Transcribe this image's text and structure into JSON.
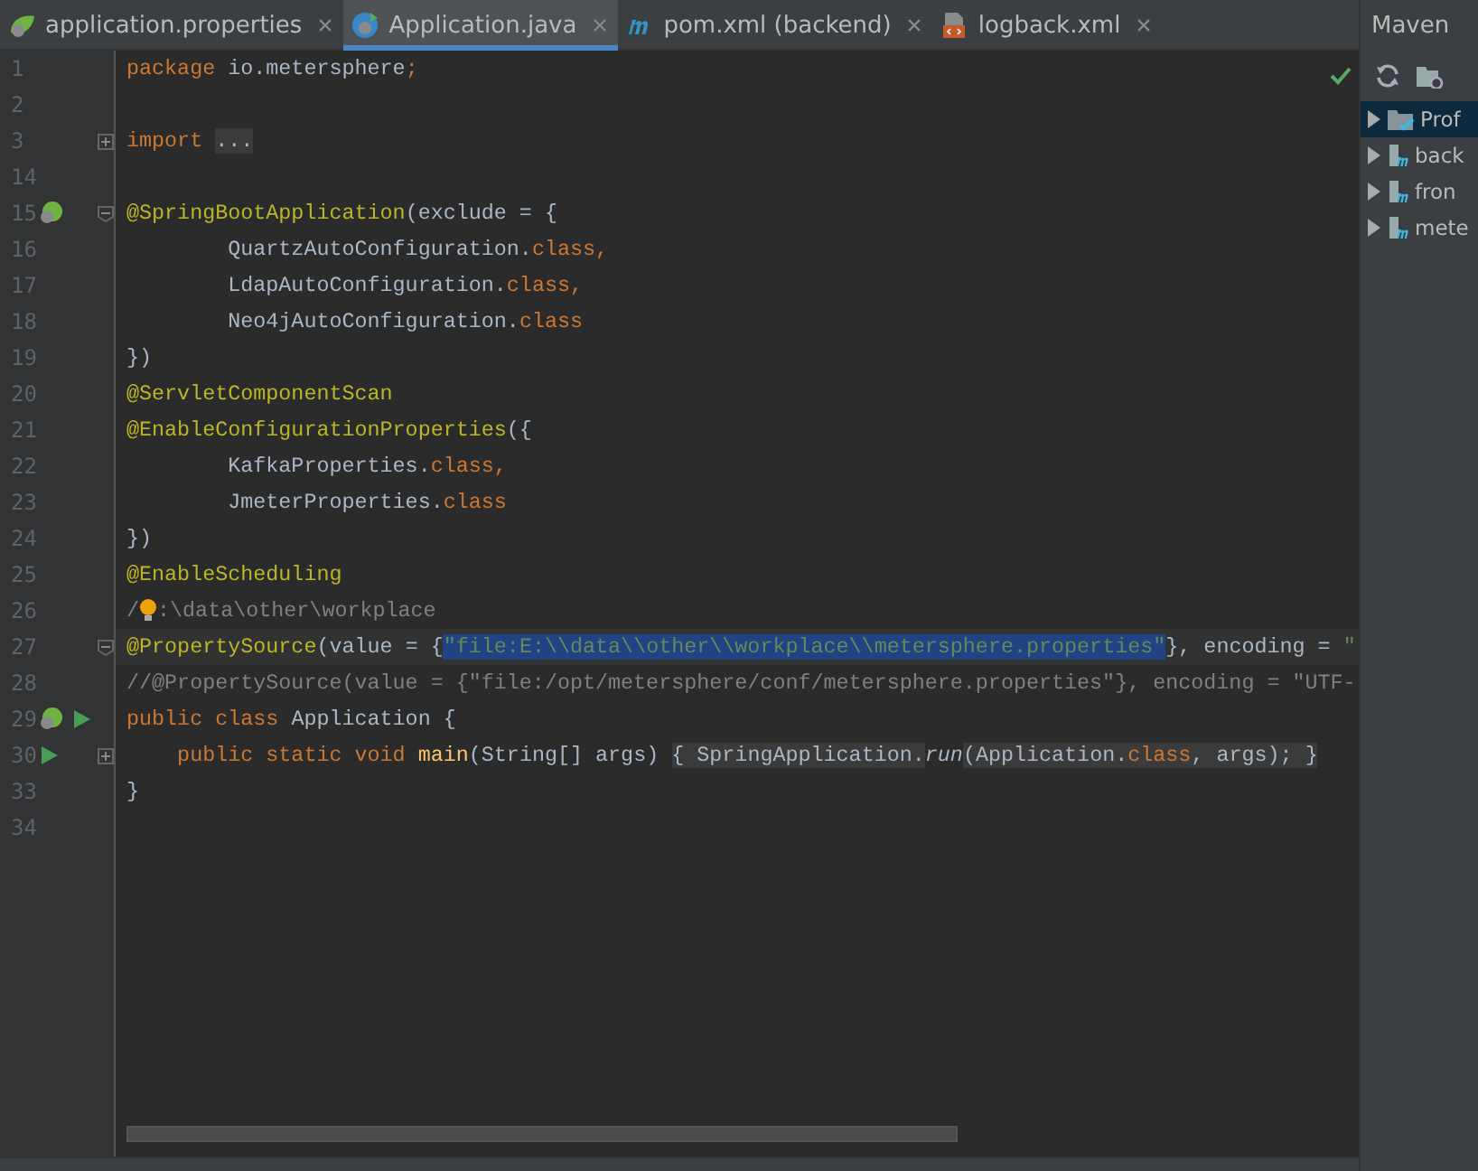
{
  "tabs": [
    {
      "label": "application.properties",
      "kind": "spring",
      "selected": false
    },
    {
      "label": "Application.java",
      "kind": "java",
      "selected": true
    },
    {
      "label": "pom.xml (backend)",
      "kind": "maven",
      "selected": false
    },
    {
      "label": "logback.xml",
      "kind": "xml",
      "selected": false
    }
  ],
  "editor": {
    "lines": [
      {
        "number": "1",
        "tokens": [
          {
            "kind": "kw",
            "text": "package "
          },
          {
            "kind": "plain",
            "text": "io.metersphere"
          },
          {
            "kind": "kw",
            "text": ";"
          }
        ]
      },
      {
        "number": "2"
      },
      {
        "number": "3",
        "fold": {
          "kind": "expand"
        },
        "tokens": [
          {
            "kind": "kw",
            "text": "import "
          },
          {
            "kind": "folded",
            "text": "..."
          }
        ]
      },
      {
        "number": "14"
      },
      {
        "number": "15",
        "fold": {
          "kind": "collapse"
        },
        "gutter": [
          {
            "kind": "bean"
          }
        ],
        "tokens": [
          {
            "kind": "ann",
            "text": "@SpringBootApplication"
          },
          {
            "kind": "plain",
            "text": "(exclude = {"
          }
        ]
      },
      {
        "number": "16",
        "tokens": [
          {
            "kind": "plain",
            "text": "        QuartzAutoConfiguration."
          },
          {
            "kind": "kw",
            "text": "class,"
          }
        ]
      },
      {
        "number": "17",
        "tokens": [
          {
            "kind": "plain",
            "text": "        LdapAutoConfiguration."
          },
          {
            "kind": "kw",
            "text": "class,"
          }
        ]
      },
      {
        "number": "18",
        "tokens": [
          {
            "kind": "plain",
            "text": "        Neo4jAutoConfiguration."
          },
          {
            "kind": "kw",
            "text": "class"
          }
        ]
      },
      {
        "number": "19",
        "tokens": [
          {
            "kind": "plain",
            "text": "})"
          }
        ]
      },
      {
        "number": "20",
        "tokens": [
          {
            "kind": "ann",
            "text": "@ServletComponentScan"
          }
        ]
      },
      {
        "number": "21",
        "tokens": [
          {
            "kind": "ann",
            "text": "@EnableConfigurationProperties"
          },
          {
            "kind": "plain",
            "text": "({"
          }
        ]
      },
      {
        "number": "22",
        "tokens": [
          {
            "kind": "plain",
            "text": "        KafkaProperties."
          },
          {
            "kind": "kw",
            "text": "class,"
          }
        ]
      },
      {
        "number": "23",
        "tokens": [
          {
            "kind": "plain",
            "text": "        JmeterProperties."
          },
          {
            "kind": "kw",
            "text": "class"
          }
        ]
      },
      {
        "number": "24",
        "tokens": [
          {
            "kind": "plain",
            "text": "})"
          }
        ]
      },
      {
        "number": "25",
        "tokens": [
          {
            "kind": "ann",
            "text": "@EnableScheduling"
          }
        ]
      },
      {
        "number": "26",
        "tokens": [
          {
            "kind": "cmt",
            "text": "/"
          },
          {
            "kind": "bulb"
          },
          {
            "kind": "cmt",
            "text": ":\\data\\other\\workplace"
          }
        ]
      },
      {
        "number": "27",
        "current": true,
        "fold": {
          "kind": "collapse"
        },
        "tokens": [
          {
            "kind": "ann",
            "text": "@PropertySource"
          },
          {
            "kind": "plain",
            "text": "(value = {"
          },
          {
            "kind": "str",
            "selected": true,
            "text": "\"file:E:\\\\data\\\\other\\\\workplace\\\\metersphere.properties\""
          },
          {
            "kind": "plain",
            "text": "}, encoding = "
          },
          {
            "kind": "str",
            "text": "\""
          }
        ]
      },
      {
        "number": "28",
        "tokens": [
          {
            "kind": "cmt",
            "text": "//@PropertySource(value = {\"file:/opt/metersphere/conf/metersphere.properties\"}, encoding = \"UTF-"
          }
        ]
      },
      {
        "number": "29",
        "gutter": [
          {
            "kind": "bean"
          },
          {
            "kind": "run"
          }
        ],
        "tokens": [
          {
            "kind": "kw",
            "text": "public class "
          },
          {
            "kind": "plain",
            "text": "Application {"
          }
        ]
      },
      {
        "number": "30",
        "fold": {
          "kind": "expand"
        },
        "gutter": [
          {
            "kind": "run"
          }
        ],
        "tokens": [
          {
            "kind": "kw",
            "text": "    public static void "
          },
          {
            "kind": "method",
            "text": "main"
          },
          {
            "kind": "plain",
            "text": "(String[] args) "
          },
          {
            "kind": "folded",
            "text": "{ SpringApplication."
          },
          {
            "kind": "italic",
            "text": "run"
          },
          {
            "kind": "folded",
            "text": "(Application."
          },
          {
            "kind": "foldedkw",
            "text": "class"
          },
          {
            "kind": "folded",
            "text": ", args); }"
          }
        ]
      },
      {
        "number": "33",
        "tokens": [
          {
            "kind": "plain",
            "text": "}"
          }
        ]
      },
      {
        "number": "34"
      }
    ]
  },
  "maven": {
    "title": "Maven",
    "items": [
      {
        "label": "Prof",
        "kind": "profiles",
        "selected": true
      },
      {
        "label": "back",
        "kind": "module",
        "selected": false
      },
      {
        "label": "fron",
        "kind": "module",
        "selected": false
      },
      {
        "label": "mete",
        "kind": "module",
        "selected": false
      }
    ]
  }
}
